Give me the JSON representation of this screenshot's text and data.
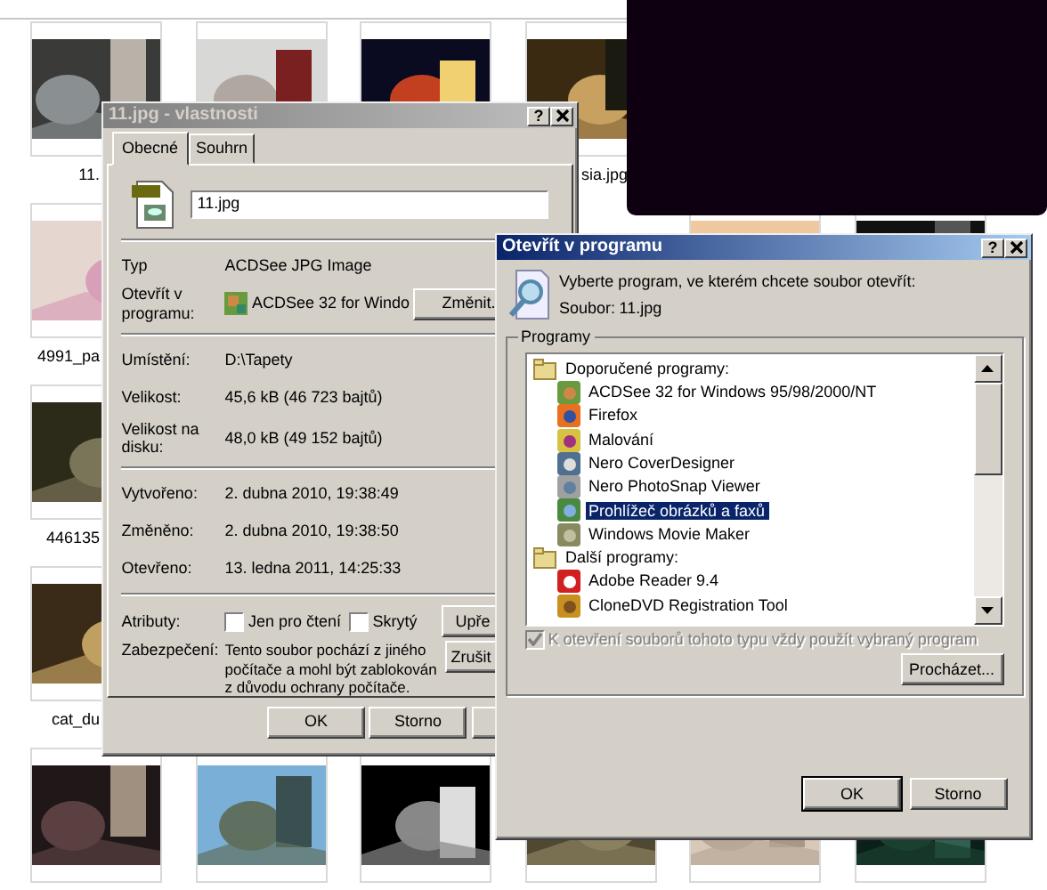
{
  "explorer": {
    "thumbnails": [
      {
        "label": "11."
      },
      {
        "kind": "picture"
      },
      {
        "kind": "picture"
      },
      {
        "label": "sia.jpg"
      },
      {
        "label": "4991_pa"
      },
      {
        "kind": "picture"
      },
      {
        "kind": "picture"
      },
      {
        "label": "446135"
      },
      {
        "label": "cat_du"
      },
      {
        "kind": "picture"
      },
      {
        "kind": "picture"
      },
      {
        "kind": "picture"
      },
      {
        "kind": "picture"
      },
      {
        "kind": "picture"
      },
      {
        "kind": "picture"
      }
    ]
  },
  "properties_dialog": {
    "title": "11.jpg - vlastnosti",
    "help": "?",
    "tabs": [
      {
        "label": "Obecné",
        "selected": true
      },
      {
        "label": "Souhrn",
        "selected": false
      }
    ],
    "file_name": "11.jpg",
    "sections": [
      [
        {
          "label": "Typ",
          "value": "ACDSee JPG Image"
        },
        {
          "label": "Otevřít v programu:",
          "value": "ACDSee 32 for Windo",
          "button": "Změnit."
        }
      ],
      [
        {
          "label": "Umístění:",
          "value": "D:\\Tapety"
        },
        {
          "label": "Velikost:",
          "value": "45,6 kB (46 723 bajtů)"
        },
        {
          "label": "Velikost na disku:",
          "value": "48,0 kB (49 152 bajtů)"
        }
      ],
      [
        {
          "label": "Vytvořeno:",
          "value": "2. dubna 2010, 19:38:49"
        },
        {
          "label": "Změněno:",
          "value": "2. dubna 2010, 19:38:50"
        },
        {
          "label": "Otevřeno:",
          "value": "13. ledna 2011, 14:25:33"
        }
      ]
    ],
    "attributes": {
      "label": "Atributy:",
      "checkboxes": [
        {
          "label": "Jen pro čtení",
          "checked": false
        },
        {
          "label": "Skrytý",
          "checked": false
        }
      ],
      "button": "Upře"
    },
    "security": {
      "label": "Zabezpečení:",
      "text": "Tento soubor pochází z jiného počítače a mohl být zablokován z důvodu ochrany počítače.",
      "button": "Zrušit"
    },
    "buttons": [
      "OK",
      "Storno"
    ]
  },
  "open_with_dialog": {
    "title": "Otevřít v programu",
    "help": "?",
    "prompt": "Vyberte program, ve kterém chcete soubor otevřít:",
    "file_label": "Soubor:",
    "file_name": "11.jpg",
    "group_label": "Programy",
    "programs": [
      {
        "label": "Doporučené programy:",
        "children": [
          {
            "label": "ACDSee 32 for Windows 95/98/2000/NT",
            "selected": false
          },
          {
            "label": "Firefox",
            "selected": false
          },
          {
            "label": "Malování",
            "selected": false
          },
          {
            "label": "Nero CoverDesigner",
            "selected": false
          },
          {
            "label": "Nero PhotoSnap Viewer",
            "selected": false
          },
          {
            "label": "Prohlížeč obrázků a faxů",
            "selected": true
          },
          {
            "label": "Windows Movie Maker",
            "selected": false
          }
        ]
      },
      {
        "label": "Další programy:",
        "children": [
          {
            "label": "Adobe Reader 9.4",
            "selected": false
          },
          {
            "label": "CloneDVD Registration Tool",
            "selected": false
          }
        ]
      }
    ],
    "always_use": {
      "label": "K otevření souborů tohoto typu vždy použít vybraný program",
      "checked": true,
      "disabled": true
    },
    "browse_button": "Procházet...",
    "buttons": [
      "OK",
      "Storno"
    ]
  }
}
